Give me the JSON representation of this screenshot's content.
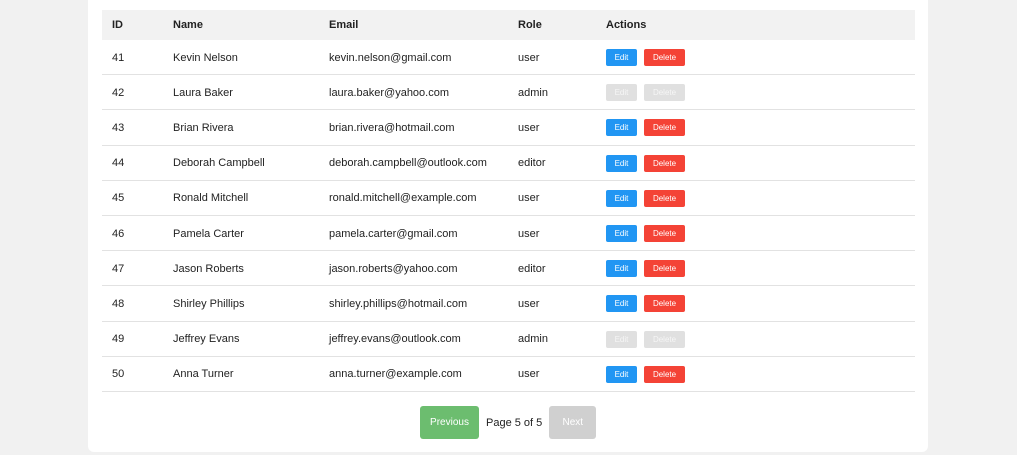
{
  "table": {
    "headers": {
      "id": "ID",
      "name": "Name",
      "email": "Email",
      "role": "Role",
      "actions": "Actions"
    },
    "edit_label": "Edit",
    "delete_label": "Delete",
    "rows": [
      {
        "id": "41",
        "name": "Kevin Nelson",
        "email": "kevin.nelson@gmail.com",
        "role": "user",
        "actions_enabled": true
      },
      {
        "id": "42",
        "name": "Laura Baker",
        "email": "laura.baker@yahoo.com",
        "role": "admin",
        "actions_enabled": false
      },
      {
        "id": "43",
        "name": "Brian Rivera",
        "email": "brian.rivera@hotmail.com",
        "role": "user",
        "actions_enabled": true
      },
      {
        "id": "44",
        "name": "Deborah Campbell",
        "email": "deborah.campbell@outlook.com",
        "role": "editor",
        "actions_enabled": true
      },
      {
        "id": "45",
        "name": "Ronald Mitchell",
        "email": "ronald.mitchell@example.com",
        "role": "user",
        "actions_enabled": true
      },
      {
        "id": "46",
        "name": "Pamela Carter",
        "email": "pamela.carter@gmail.com",
        "role": "user",
        "actions_enabled": true
      },
      {
        "id": "47",
        "name": "Jason Roberts",
        "email": "jason.roberts@yahoo.com",
        "role": "editor",
        "actions_enabled": true
      },
      {
        "id": "48",
        "name": "Shirley Phillips",
        "email": "shirley.phillips@hotmail.com",
        "role": "user",
        "actions_enabled": true
      },
      {
        "id": "49",
        "name": "Jeffrey Evans",
        "email": "jeffrey.evans@outlook.com",
        "role": "admin",
        "actions_enabled": false
      },
      {
        "id": "50",
        "name": "Anna Turner",
        "email": "anna.turner@example.com",
        "role": "user",
        "actions_enabled": true
      }
    ]
  },
  "pagination": {
    "previous_label": "Previous",
    "page_info": "Page 5 of 5",
    "next_label": "Next",
    "current_page": 5,
    "total_pages": 5
  },
  "colors": {
    "edit": "#2196f3",
    "delete": "#f44336",
    "disabled": "#e0e0e0",
    "previous": "#6cbd6f",
    "next_disabled": "#d0d0d0"
  }
}
